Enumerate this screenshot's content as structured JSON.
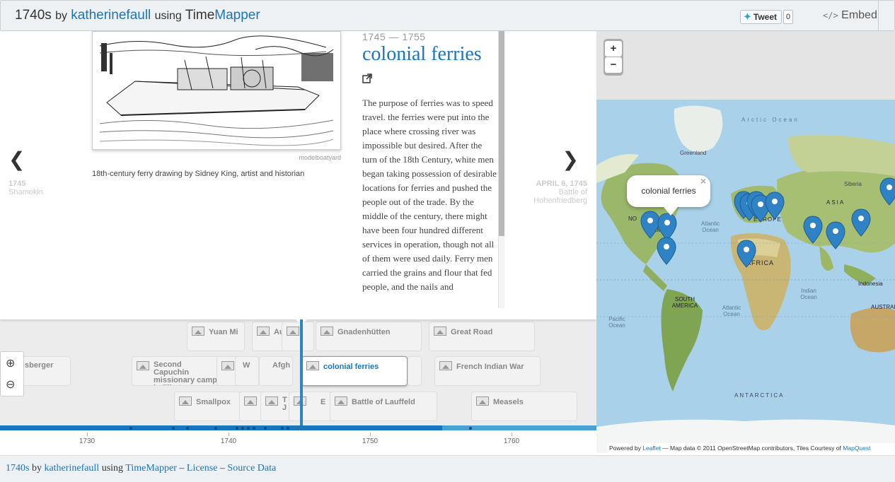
{
  "header": {
    "title_prefix": "1740s",
    "by": "by",
    "author": "katherinefaull",
    "using": "using",
    "app_time": "Time",
    "app_mapper": "Mapper",
    "tweet_label": "Tweet",
    "tweet_count": "0",
    "embed_label": "Embed"
  },
  "slide": {
    "image_credit": "modelboatyard",
    "image_caption": "18th-century ferry drawing by Sidney King, artist and historian",
    "date_range": "1745 — 1755",
    "headline": "colonial ferries",
    "body": "The purpose of ferries was to speed travel. the ferries were put into the place where crossing river was impossible but desired. After the turn of the 18th Century, white men began taking possession of desirable locations for ferries and pushed the people out of the trade. By the middle of the century, there might have been four hundred different services in operation, though not all of them were used daily. Ferry men carried the grains and flour that fed people, and the nails and"
  },
  "nav": {
    "prev_date": "1745",
    "prev_title": "Shamokin",
    "next_date": "APRIL 6, 1745",
    "next_title": "Battle of Hohenfriedberg"
  },
  "timeline": {
    "markers": [
      {
        "label": "Yuan Mi"
      },
      {
        "label": "Au"
      },
      {
        "label": ""
      },
      {
        "label": "Gnadenhütten"
      },
      {
        "label": "Great Road"
      },
      {
        "label": "sberger"
      },
      {
        "label": "Second Capuchin missionary camp in Tibet"
      },
      {
        "label": ""
      },
      {
        "label": "W"
      },
      {
        "label": "Afgh"
      },
      {
        "label": "colonial ferries"
      },
      {
        "label": "French Indian War"
      },
      {
        "label": "Smallpox"
      },
      {
        "label": "T"
      },
      {
        "label": "T J"
      },
      {
        "label": "E"
      },
      {
        "label": "Battle of Lauffeld"
      },
      {
        "label": "Measels"
      }
    ],
    "axis_labels": [
      "1730",
      "1740",
      "1750",
      "1760"
    ]
  },
  "map": {
    "popup_label": "colonial ferries",
    "popup_close": "×",
    "zoom_in": "+",
    "zoom_out": "−",
    "labels": [
      "Greenland",
      "Arctic Ocean",
      "Siberia",
      "NO",
      "AM",
      "EUROPE",
      "ASIA",
      "Atlantic Ocean",
      "AFRICA",
      "Indonesia",
      "SOUTH AMERICA",
      "Atlantic Ocean",
      "Indian Ocean",
      "Pacific Ocean",
      "AUSTRALIA",
      "ANTARCTICA"
    ],
    "attribution": {
      "powered": "Powered by",
      "leaflet": "Leaflet",
      "rest": "— Map data © 2011 OpenStreetMap contributors, Tiles Courtesy of",
      "mapquest": "MapQuest"
    },
    "colors": {
      "marker": "#2f82c4",
      "water": "#a5cfe8",
      "land": "#c9d98a"
    }
  },
  "footer": {
    "title": "1740s",
    "by": "by",
    "author": "katherinefaull",
    "using": "using",
    "app": "TimeMapper",
    "dash1": "–",
    "license": "License",
    "dash2": "–",
    "source": "Source Data"
  }
}
